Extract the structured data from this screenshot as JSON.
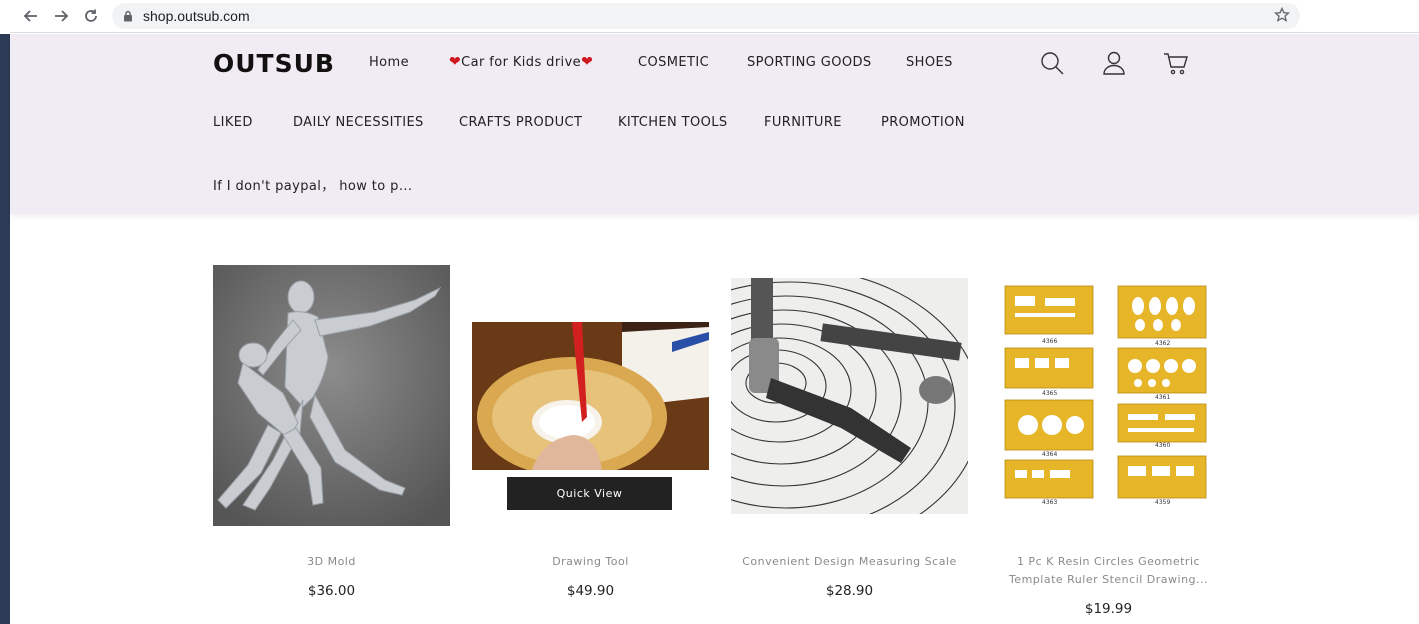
{
  "browser": {
    "url": "shop.outsub.com"
  },
  "header": {
    "logo": "OUTSUB",
    "nav_row1": [
      "Home",
      "Car for Kids drive",
      "COSMETIC",
      "SPORTING GOODS",
      "SHOES"
    ],
    "nav_row2": [
      "LIKED",
      "DAILY NECESSITIES",
      "CRAFTS PRODUCT",
      "KITCHEN TOOLS",
      "FURNITURE",
      "PROMOTION"
    ],
    "nav_row3": [
      "If I don't paypal， how to p..."
    ],
    "icons": [
      "search-icon",
      "account-icon",
      "cart-icon"
    ]
  },
  "products": [
    {
      "name": "3D Mold",
      "price": "$36.00"
    },
    {
      "name": "Drawing Tool",
      "price": "$49.90",
      "quick_view": "Quick View"
    },
    {
      "name": "Convenient Design Measuring Scale",
      "price": "$28.90"
    },
    {
      "name": "1 Pc K Resin Circles Geometric Template Ruler Stencil Drawing...",
      "price": "$19.99"
    }
  ],
  "stencil_codes": [
    "4366",
    "4362",
    "4365",
    "4361",
    "4364",
    "4360",
    "4363",
    "4359"
  ],
  "colors": {
    "header_bg": "#f1ebf4",
    "heart": "#d0161e",
    "quick_view_bg": "#222222"
  }
}
